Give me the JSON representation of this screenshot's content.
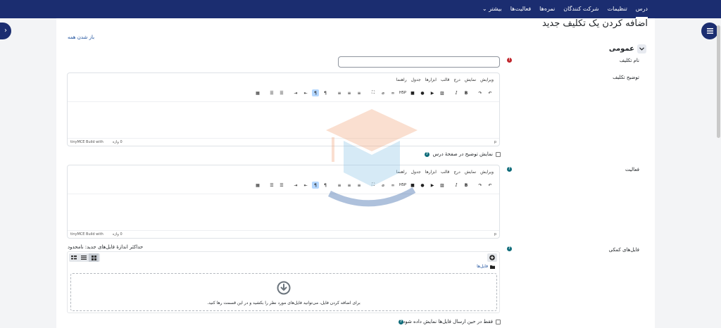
{
  "nav": {
    "items": [
      {
        "label": "درس",
        "active": true
      },
      {
        "label": "تنظیمات",
        "active": false
      },
      {
        "label": "شرکت کنندگان",
        "active": false
      },
      {
        "label": "نمره‌ها",
        "active": false
      },
      {
        "label": "فعالیت‌ها",
        "active": false
      },
      {
        "label": "بیشتر",
        "active": false
      }
    ],
    "more_arrow": "⌄"
  },
  "page": {
    "title": "اضافه کردن یک تکلیف جدید",
    "expand_all": "باز شدن همه"
  },
  "section": {
    "title": "عمومی"
  },
  "fields": {
    "name_label": "نام تکلیف",
    "description_label": "توضیح تکلیف",
    "activity_label": "فعالیت",
    "files_label": "فایل‌های کمکی",
    "name_value": ""
  },
  "editor": {
    "menu": [
      "ویرایش",
      "نمایش",
      "درج",
      "قالب",
      "ابزارها",
      "جدول",
      "راهنما"
    ],
    "status_path": "p",
    "word_count": "0 واژه",
    "brand": "tinyMCE Build with"
  },
  "checkboxes": {
    "show_description": "نمایش توضیح در صفحهٔ درس",
    "only_during_submission": "فقط در حین ارسال فایل‌ها نمایش داده شود"
  },
  "filepicker": {
    "max_size": "حداکثر اندازهٔ فایل‌های جدید: نامحدود",
    "folder": "فایل‌ها",
    "drop_message": "برای اضافه کردن فایل، می‌توانید فایل‌های مورد نظر را بکشید و در این قسمت رها کنید."
  },
  "colors": {
    "navbar": "#1b2d70",
    "required": "#c1272d",
    "help": "#0f6c7a",
    "link": "#1b4f9c"
  }
}
